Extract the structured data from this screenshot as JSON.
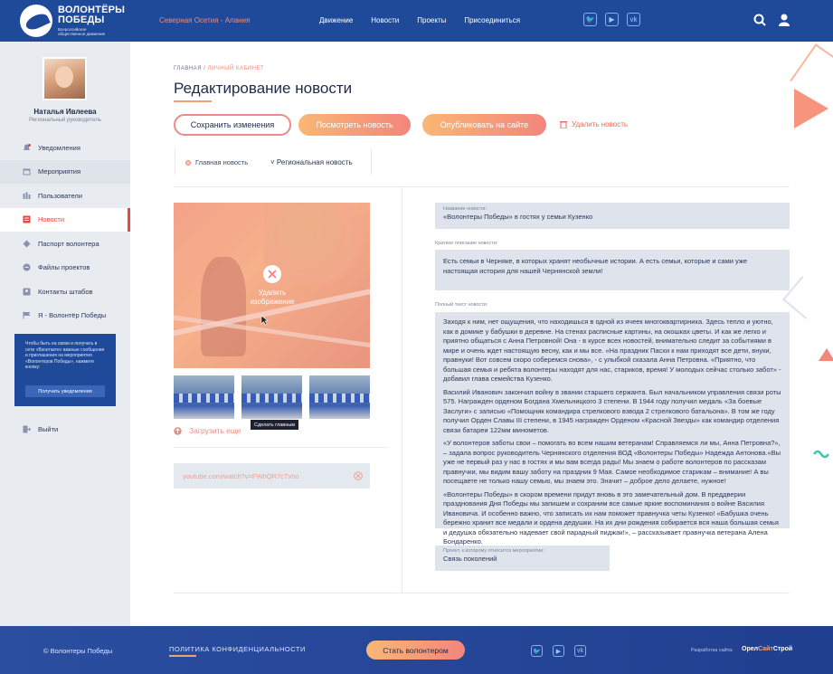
{
  "header": {
    "logo_title_1": "ВОЛОНТЁРЫ",
    "logo_title_2": "ПОБЕДЫ",
    "logo_subtitle": "Всероссийское общественное движение",
    "region": "Северная Осетия - Алания",
    "nav": [
      "Движение",
      "Новости",
      "Проекты",
      "Присоединиться"
    ],
    "social_icons": [
      "twitter-icon",
      "youtube-icon",
      "vk-icon"
    ],
    "social_glyphs": [
      "🐦",
      "▶",
      "vk"
    ]
  },
  "sidebar": {
    "user_name": "Наталья Ивлеева",
    "user_role": "Региональный руководитель",
    "items": [
      {
        "label": "Уведомления",
        "icon": "bell-icon"
      },
      {
        "label": "Мероприятия",
        "icon": "calendar-icon"
      },
      {
        "label": "Пользователи",
        "icon": "users-icon"
      },
      {
        "label": "Новости",
        "icon": "news-icon"
      },
      {
        "label": "Паспорт волонтера",
        "icon": "passport-icon"
      },
      {
        "label": "Файлы проектов",
        "icon": "files-icon"
      },
      {
        "label": "Контакты штабов",
        "icon": "contacts-icon"
      },
      {
        "label": "Я - Волонтёр Победы",
        "icon": "flag-icon"
      }
    ],
    "notice_text": "Чтобы быть на связи и получать в сети «Вконтакте» важные сообщения и приглашения на мероприятия «Волонтеров Победы», нажмите кнопку:",
    "notice_button": "Получать уведомления",
    "logout": "Выйти"
  },
  "page": {
    "breadcrumb_home": "ГЛАВНАЯ",
    "breadcrumb_sep": "/",
    "breadcrumb_current": "ЛИЧНЫЙ КАБИНЕТ",
    "title": "Редактирование новости",
    "btn_save": "Сохранить изменения",
    "btn_view": "Посмотреть новость",
    "btn_publish": "Опубликовать на сайте",
    "btn_delete": "Удалить новость",
    "type_main": "Главная новость",
    "type_regional": "Региональная новость",
    "delete_image": "Удалить изображение",
    "make_main_tooltip": "Сделать главным",
    "upload_more": "Загрузить еще",
    "youtube_placeholder": "youtube.com/watch?v=FWhQR7cTxho"
  },
  "form": {
    "name_label": "Название новости:",
    "name_value": "«Волонтеры Победы» в гостях у семьи Кузенко",
    "short_label": "Краткое описание новости:",
    "short_value": "Есть семьи в Черняке, в которых хранят необычные истории. А есть семьи, которые и сами уже настоящая история для нашей Чернянской земли!",
    "full_label": "Полный текст новости:",
    "full_paragraphs": [
      "Заходя к ним, нет ощущения, что находишься в одной из ячеек многоквартирника. Здесь тепло и уютно, как в домике у бабушки в деревне. На стенах расписные картины, на окошках цветы. И как же легко и приятно общаться с Анна Петровной! Она - в курсе всех новостей, внимательно следит за событиями в мире и очень ждет настоящую весну, как и мы все. «На праздник Пасхи к нам приходят все дети, внуки, правнуки! Вот совсем скоро соберемся снова», - с улыбкой сказала Анна Петровна. «Приятно, что большая семья и ребята волонтеры находят для нас, стариков, время! У молодых сейчас столько забот» - добавил глава семейства Кузенко.",
      "Василий Иванович закончил войну в звании старшего сержанта. Был начальником управления связи роты 575. Награжден орденом Богдана Хмельницкого 3 степени. В 1944 году получил медаль «За боевые Заслуги» с записью «Помощник командира стрелкового взвода 2 стрелкового батальона». В том же году получил Орден Славы III степени, в 1945 награжден Орденом «Красной Звезды» как командир отделения связи батареи 122мм минометов.",
      "«У волонтеров заботы свои – помогать во всем нашим ветеранам! Справляемся ли мы, Анна Петровна?», – задала вопрос руководитель Чернянского отделения ВОД «Волонтеры Победы» Надежда Антонова.«Вы уже не первый раз у нас в гостях и мы вам всегда рады! Мы знаем о работе волонтеров по рассказам правнучки, мы видим вашу заботу на праздник 9 Мая. Самое необходимое старикам – внимание! А вы посещаете не только нашу семью, мы знаем это. Значит – доброе дело делаете, нужное!",
      "«Волонтеры Победы» в скором времени придут вновь в это замечательный дом. В преддверии празднования Дня Победы мы запишем и сохраним все самые яркие воспоминания о войне Василия Ивановича. И особенно важно, что записать их нам поможет правнучка четы Кузенко! «Бабушка очень бережно хранит все медали и ордена дедушки. На их дни рождения собирается вся наша большая семья и дедушка обязательно надевает свой парадный пиджак!», – рассказывает правнучка ветерана Алена Бондаренко."
    ],
    "project_label": "Проект, к которому относится мероприятие:",
    "project_value": "Связь поколений"
  },
  "footer": {
    "copyright": "© Волонтеры Победы",
    "policy": "ПОЛИТИКА КОНФИДЕНЦИАЛЬНОСТИ",
    "cta": "Стать волонтером",
    "dev_label": "Разработка сайта:",
    "dev_name_1": "Орел",
    "dev_name_2": "Сайт",
    "dev_name_3": "Строй"
  },
  "colors": {
    "brand_blue": "#1f4a9a",
    "accent_coral": "#f3857c",
    "accent_peach": "#f9b774"
  }
}
